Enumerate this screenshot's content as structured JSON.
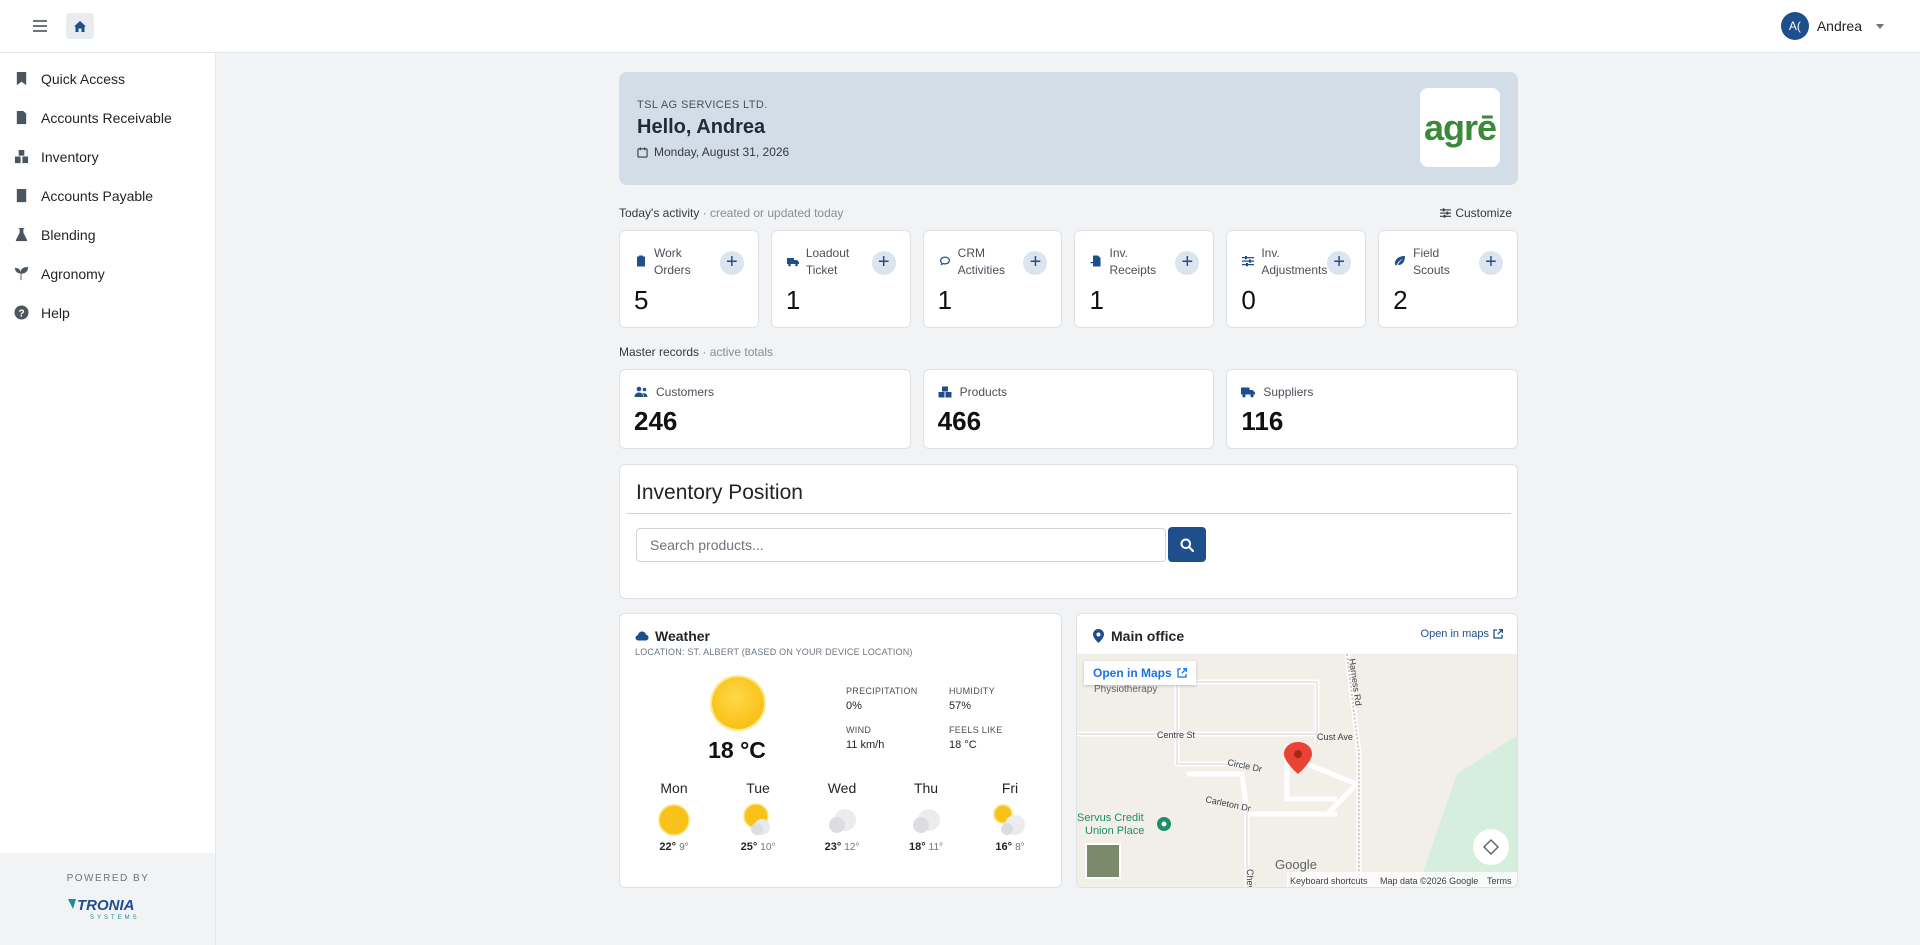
{
  "topbar": {
    "avatar_initials": "A(",
    "user_name": "Andrea"
  },
  "sidebar": {
    "items": [
      {
        "label": "Quick Access",
        "icon": "bookmark-icon"
      },
      {
        "label": "Accounts Receivable",
        "icon": "invoice-icon"
      },
      {
        "label": "Inventory",
        "icon": "boxes-icon"
      },
      {
        "label": "Accounts Payable",
        "icon": "bill-icon"
      },
      {
        "label": "Blending",
        "icon": "flask-icon"
      },
      {
        "label": "Agronomy",
        "icon": "seedling-icon"
      },
      {
        "label": "Help",
        "icon": "question-icon"
      }
    ],
    "powered_by": "POWERED BY",
    "brand": "TRONIA",
    "brand_sub": "SYSTEMS"
  },
  "hero": {
    "company": "TSL AG SERVICES LTD.",
    "greeting": "Hello, Andrea",
    "date": "Monday, August 31, 2026",
    "logo_text": "agrē"
  },
  "activity": {
    "title": "Today's activity",
    "subtitle": " · created or updated today",
    "customize_label": "Customize",
    "cards": [
      {
        "line1": "Work",
        "line2": "Orders",
        "value": "5",
        "icon": "clipboard-icon"
      },
      {
        "line1": "Loadout",
        "line2": "Ticket",
        "value": "1",
        "icon": "truck-icon"
      },
      {
        "line1": "CRM",
        "line2": "Activities",
        "value": "1",
        "icon": "chat-icon"
      },
      {
        "line1": "Inv.",
        "line2": "Receipts",
        "value": "1",
        "icon": "receipt-icon"
      },
      {
        "line1": "Inv.",
        "line2": "Adjustments",
        "value": "0",
        "icon": "sliders-icon"
      },
      {
        "line1": "Field",
        "line2": "Scouts",
        "value": "2",
        "icon": "leaf-icon"
      }
    ]
  },
  "masters": {
    "title": "Master records",
    "subtitle": " · active totals",
    "cards": [
      {
        "label": "Customers",
        "value": "246",
        "icon": "users-icon"
      },
      {
        "label": "Products",
        "value": "466",
        "icon": "boxes-icon"
      },
      {
        "label": "Suppliers",
        "value": "116",
        "icon": "truck-icon"
      }
    ]
  },
  "inventory": {
    "title": "Inventory Position",
    "search_placeholder": "Search products..."
  },
  "weather": {
    "title": "Weather",
    "location": "LOCATION: ST. ALBERT (BASED ON YOUR DEVICE LOCATION)",
    "temperature": "18 °C",
    "precipitation_label": "PRECIPITATION",
    "precipitation": "0%",
    "humidity_label": "HUMIDITY",
    "humidity": "57%",
    "wind_label": "WIND",
    "wind": "11 km/h",
    "feels_like_label": "FEELS LIKE",
    "feels_like": "18 °C",
    "forecast": [
      {
        "day": "Mon",
        "high": "22°",
        "low": "9°",
        "icon": "sun-icon"
      },
      {
        "day": "Tue",
        "high": "25°",
        "low": "10°",
        "icon": "partly-cloudy-icon"
      },
      {
        "day": "Wed",
        "high": "23°",
        "low": "12°",
        "icon": "cloud-icon"
      },
      {
        "day": "Thu",
        "high": "18°",
        "low": "11°",
        "icon": "cloud-icon"
      },
      {
        "day": "Fri",
        "high": "16°",
        "low": "8°",
        "icon": "partly-cloudy-icon"
      }
    ]
  },
  "map": {
    "title": "Main office",
    "open_link": "Open in maps",
    "open_button": "Open in Maps",
    "labels": {
      "physio": "Physiotherapy",
      "centre": "Centre St",
      "circle": "Circle Dr",
      "carleton": "Carleton Dr",
      "cust": "Cust Ave",
      "harness": "Harness Rd",
      "servus1": "Servus Credit",
      "servus2": "Union Place",
      "chev": "Chev"
    },
    "google": "Google",
    "keyboard": "Keyboard shortcuts",
    "map_data": "Map data ©2026 Google",
    "terms": "Terms"
  }
}
